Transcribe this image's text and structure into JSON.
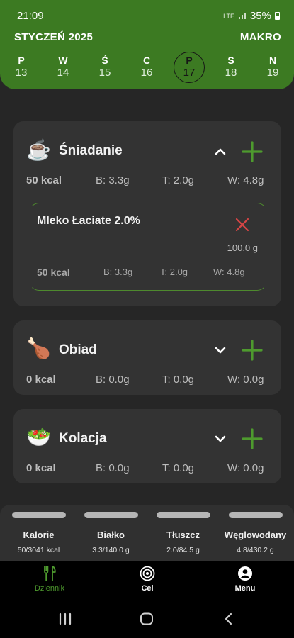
{
  "status": {
    "time": "21:09",
    "network": "LTE",
    "battery": "35%"
  },
  "header": {
    "month": "STYCZEŃ 2025",
    "makro_label": "MAKRO",
    "days": [
      {
        "letter": "P",
        "num": "13"
      },
      {
        "letter": "W",
        "num": "14"
      },
      {
        "letter": "Ś",
        "num": "15"
      },
      {
        "letter": "C",
        "num": "16"
      },
      {
        "letter": "P",
        "num": "17",
        "selected": true
      },
      {
        "letter": "S",
        "num": "18"
      },
      {
        "letter": "N",
        "num": "19"
      }
    ]
  },
  "meals": {
    "breakfast": {
      "title": "Śniadanie",
      "icon": "hot-drink-icon",
      "expanded": true,
      "kcal": "50 kcal",
      "protein": "B: 3.3g",
      "fat": "T: 2.0g",
      "carbs": "W: 4.8g",
      "entry": {
        "name": "Mleko Łaciate 2.0%",
        "qty": "100.0 g",
        "kcal": "50 kcal",
        "protein": "B: 3.3g",
        "fat": "T: 2.0g",
        "carbs": "W: 4.8g"
      }
    },
    "lunch": {
      "title": "Obiad",
      "icon": "roast-chicken-icon",
      "expanded": false,
      "kcal": "0 kcal",
      "protein": "B: 0.0g",
      "fat": "T: 0.0g",
      "carbs": "W: 0.0g"
    },
    "dinner": {
      "title": "Kolacja",
      "icon": "salad-icon",
      "expanded": false,
      "kcal": "0 kcal",
      "protein": "B: 0.0g",
      "fat": "T: 0.0g",
      "carbs": "W: 0.0g"
    }
  },
  "summary": [
    {
      "label": "Kalorie",
      "value": "50/3041 kcal"
    },
    {
      "label": "Białko",
      "value": "3.3/140.0 g"
    },
    {
      "label": "Tłuszcz",
      "value": "2.0/84.5 g"
    },
    {
      "label": "Węglowodany",
      "value": "4.8/430.2 g"
    }
  ],
  "nav": [
    {
      "label": "Dziennik",
      "icon": "cutlery-icon",
      "active": true
    },
    {
      "label": "Cel",
      "icon": "target-icon",
      "active": false
    },
    {
      "label": "Menu",
      "icon": "account-icon",
      "active": false
    }
  ],
  "colors": {
    "header": "#3c7a22",
    "accent": "#4e9a2e",
    "remove": "#d64545",
    "background": "#262626",
    "card": "#333333"
  }
}
